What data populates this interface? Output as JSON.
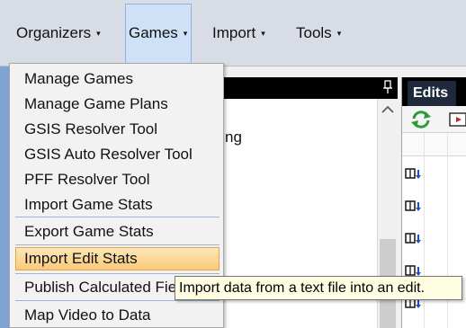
{
  "menubar": {
    "items": [
      {
        "label": "Organizers"
      },
      {
        "label": "Games"
      },
      {
        "label": "Import"
      },
      {
        "label": "Tools"
      }
    ],
    "caret": "▾"
  },
  "dropdown": {
    "items": [
      {
        "label": "Manage Games"
      },
      {
        "label": "Manage Game Plans"
      },
      {
        "label": "GSIS Resolver Tool"
      },
      {
        "label": "GSIS Auto Resolver Tool"
      },
      {
        "label": "PFF Resolver Tool"
      },
      {
        "label": "Import Game Stats"
      },
      {
        "label": "Export Game Stats"
      },
      {
        "label": "Import Edit Stats"
      },
      {
        "label": "Publish Calculated Fields"
      },
      {
        "label": "Map Video to Data"
      }
    ],
    "highlighted": "Import Edit Stats"
  },
  "background_panel": {
    "partial_text": "ng"
  },
  "edits_panel": {
    "tab_label": "Edits"
  },
  "tooltip": {
    "text": "Import data from a text file into an edit."
  },
  "colors": {
    "accent": "#7fa3d2",
    "highlight": "#f9c97a",
    "tooltip_bg": "#fffde1"
  }
}
